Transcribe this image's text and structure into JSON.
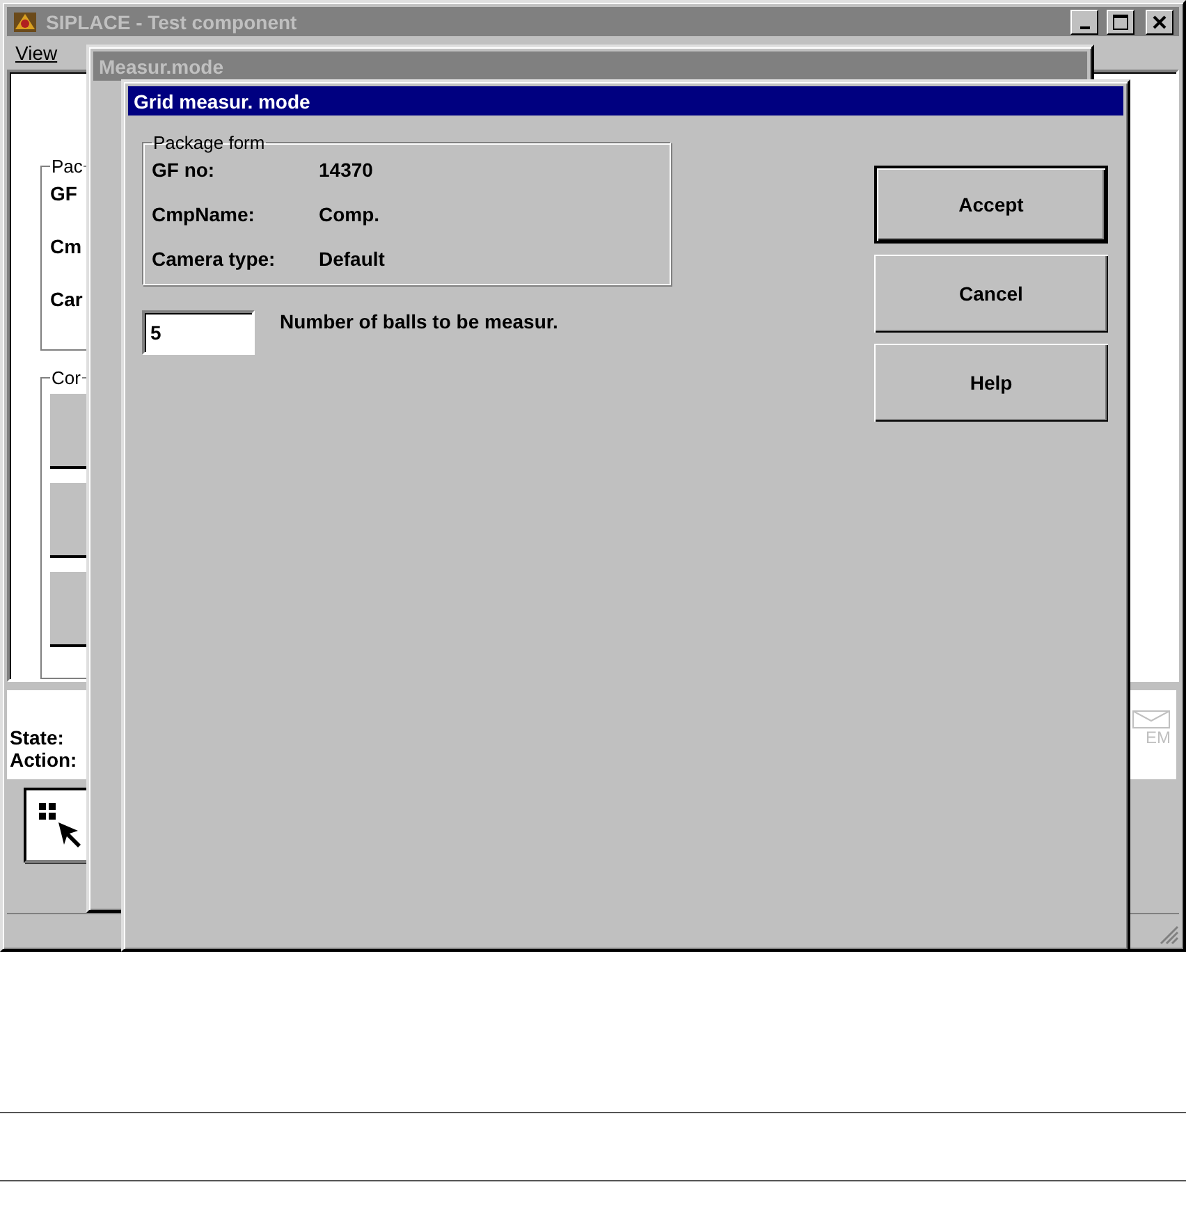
{
  "main_window": {
    "title": "SIPLACE - Test component",
    "active": false,
    "menu": [
      "View"
    ],
    "package_group": {
      "legend": "Pac",
      "labels": [
        "GF",
        "Cm",
        "Car"
      ]
    },
    "component_group": {
      "legend": "Cor"
    },
    "status": [
      "State:",
      "Action:"
    ],
    "logo_text": "EM"
  },
  "measure_window": {
    "title": "Measur.mode",
    "active": false
  },
  "dialog": {
    "title": "Grid measur. mode",
    "active": true,
    "package_form": {
      "legend": "Package form",
      "fields": [
        {
          "label": "GF no:",
          "value": "14370"
        },
        {
          "label": "CmpName:",
          "value": "Comp."
        },
        {
          "label": "Camera type:",
          "value": "Default"
        }
      ]
    },
    "balls": {
      "value": "5",
      "label": "Number of balls to be measur."
    },
    "buttons": [
      {
        "label": "Accept",
        "default": true
      },
      {
        "label": "Cancel",
        "default": false
      },
      {
        "label": "Help",
        "default": false
      }
    ]
  }
}
